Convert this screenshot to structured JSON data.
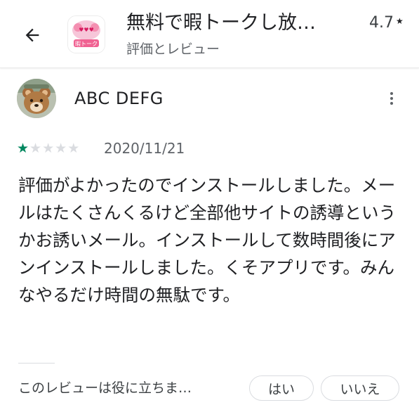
{
  "header": {
    "back_icon": "arrow-left-icon",
    "app_icon": "app-icon",
    "app_icon_label": "暇トーク",
    "app_title": "無料で暇トークし放…",
    "subtitle": "評価とレビュー",
    "rating": "4.7",
    "rating_star": "★"
  },
  "review": {
    "avatar_icon": "bear-avatar",
    "author": "ABC DEFG",
    "more_icon": "more-vertical-icon",
    "stars_filled": 1,
    "stars_total": 5,
    "star_color_filled": "#01875f",
    "star_color_empty": "#dadce0",
    "date": "2020/11/21",
    "text": "評価がよかったのでインストールしました。メールはたくさんくるけど全部他サイトの誘導というかお誘いメール。インストールして数時間後にアンインストールしました。くそアプリです。みんなやるだけ時間の無駄です。"
  },
  "helpful": {
    "question": "このレビューは役に立ちま…",
    "yes_label": "はい",
    "no_label": "いいえ"
  }
}
